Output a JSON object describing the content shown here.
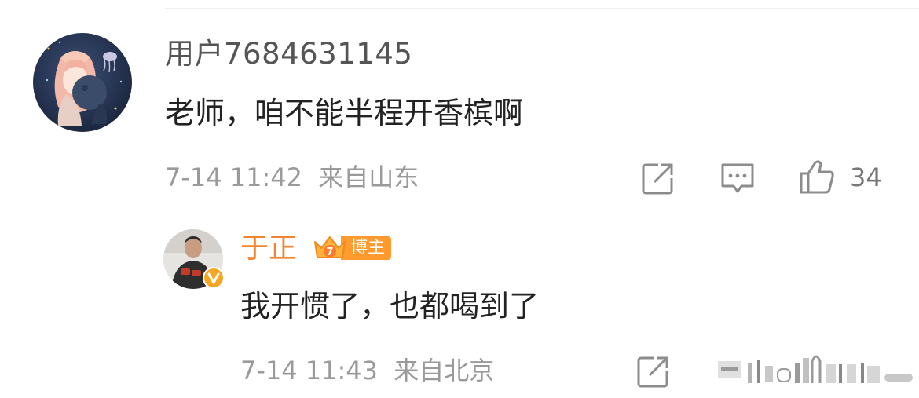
{
  "comment": {
    "username": "用户7684631145",
    "text": "老师，咱不能半程开香槟啊",
    "timestamp": "7-14 11:42",
    "location": "来自山东",
    "like_count": "34",
    "avatar": "anime-girl-jellyfish-avatar"
  },
  "reply": {
    "username": "于正",
    "badge_label": "博主",
    "badge_level": "7",
    "text": "我开惯了，也都喝到了",
    "timestamp": "7-14 11:43",
    "location": "来自北京",
    "avatar": "man-portrait-avatar"
  },
  "icons": {
    "share": "share-icon",
    "comment": "comment-icon",
    "like": "thumbs-up-icon",
    "verified": "verified-v-icon",
    "crown": "crown-icon"
  },
  "colors": {
    "username_main": "#555555",
    "username_reply": "#f28532",
    "meta": "#9a9a9a",
    "badge_orange": "#ff9a2e",
    "verified_gold": "#f5a623"
  }
}
